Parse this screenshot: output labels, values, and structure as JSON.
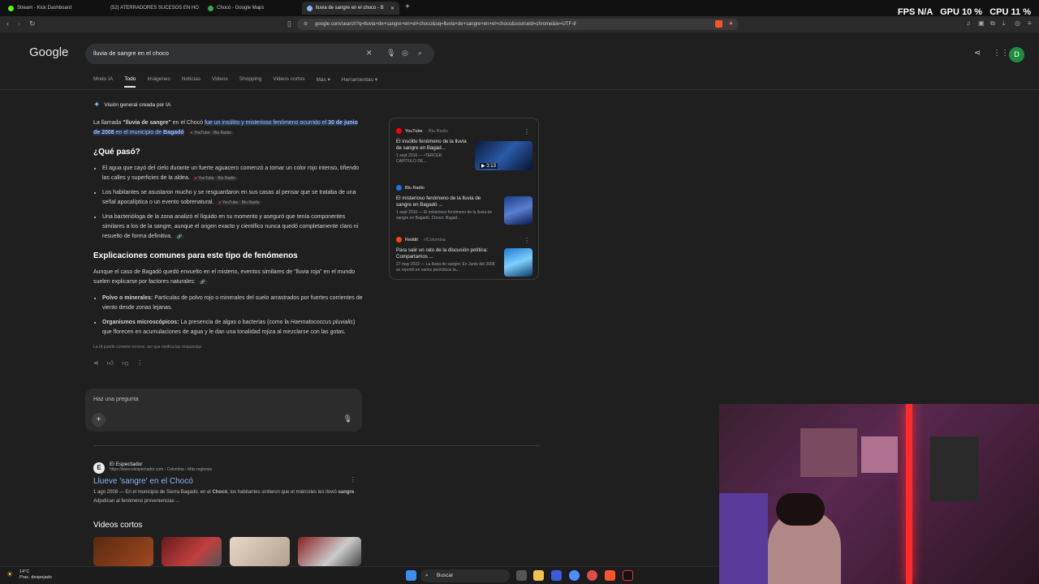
{
  "tabs": [
    {
      "label": "Stream - Kick Dashboard",
      "color": "#53fc18"
    },
    {
      "label": "(52) ATERRADORES SUCESOS EN HO",
      "color": "#ff0000"
    },
    {
      "label": "Chocó - Google Maps",
      "color": "#34a853"
    },
    {
      "label": "lluvia de sangre en el choco - B",
      "color": "#8ab4f8"
    }
  ],
  "address": {
    "url": "google.com/search?q=lluvia+de+sangre+en+el+choco&oq=lluvia+de+sangre+en+el+choco&sourceid=chrome&ie=UTF-8"
  },
  "hud": {
    "fps_label": "FPS",
    "fps": "N/A",
    "gpu_label": "GPU",
    "gpu": "10 %",
    "cpu_label": "CPU",
    "cpu": "11 %"
  },
  "google": {
    "logo": "Google",
    "query": "lluvia de sangre en el choco",
    "avatar": "D",
    "nav_tabs": [
      "Modo IA",
      "Todo",
      "Imágenes",
      "Noticias",
      "Videos",
      "Shopping",
      "Videos cortos",
      "Más ▾",
      "Herramientas ▾"
    ]
  },
  "ai": {
    "header": "Visión general creada por IA",
    "intro_pre": "La llamada ",
    "intro_bold": "\"lluvia de sangre\"",
    "intro_mid": " en el Chocó ",
    "intro_hl1": "fue un insólito y misterioso fenómeno ocurrido el ",
    "intro_hl_date": "30 de junio de 2008",
    "intro_hl2": " en el municipio de ",
    "intro_hl_place": "Bagadó",
    "intro_pill": "YouTube · Blu Radio",
    "h_what": "¿Qué pasó?",
    "what_items": [
      {
        "text": "El agua que cayó del cielo durante un fuerte aguacero comenzó a tomar un color rojo intenso, tiñendo las calles y superficies de la aldea.",
        "pill": "YouTube · Blu Radio"
      },
      {
        "text": "Los habitantes se asustaron mucho y se resguardaron en sus casas al pensar que se trataba de una señal apocalíptica o un evento sobrenatural.",
        "pill": "YouTube · Blu Radio"
      },
      {
        "text": "Una bacterióloga de la zona analizó el líquido en su momento y aseguró que tenía componentes similares a los de la sangre, aunque el origen exacto y científico nunca quedó completamente claro ni resuelto de forma definitiva.",
        "pill": "🔗"
      }
    ],
    "h_expl": "Explicaciones comunes para este tipo de fenómenos",
    "expl_intro": "Aunque el caso de Bagadó quedó envuelto en el misterio, eventos similares de \"lluvia roja\" en el mundo suelen explicarse por factores naturales:",
    "expl_items": [
      {
        "bold": "Polvo o minerales:",
        "text": " Partículas de polvo rojo o minerales del suelo arrastrados por fuertes corrientes de viento desde zonas lejanas."
      },
      {
        "bold": "Organismos microscópicos:",
        "text": " La presencia de algas o bacterias (como la ",
        "ital": "Haematococcus pluvialis",
        "text2": ") que florecen en acumulaciones de agua y le dan una tonalidad rojiza al mezclarse con las gotas."
      }
    ],
    "disclaimer": "La IA puede cometer errores, así que verifica las respuestas"
  },
  "card": [
    {
      "source": "YouTube",
      "sub": "· Blu Radio",
      "dot": "#ff0000",
      "title": "El insólito fenómeno de la lluvia de sangre en Bagad...",
      "snippet": "1 sept 2016 — •TERCER CAPÍTULO DE...",
      "duration": "▶ 3:13"
    },
    {
      "source": "Blu Radio",
      "sub": "",
      "dot": "#1a73e8",
      "title": "El misterioso fenómeno de la lluvia de sangre en Bagadó ...",
      "snippet": "1 sept 2016 — El misterioso fenómeno de la lluvia de sangre en Bagadó, Chocó. Bagad..."
    },
    {
      "source": "Reddit",
      "sub": "· r/Colombia",
      "dot": "#ff4500",
      "title": "Para salir un rato de la discusión política: Compartamos ...",
      "snippet": "27 may 2022 — La lluvia de sangre: En Junio del 2008 se reportó en varios periódicos la..."
    }
  ],
  "ask": {
    "placeholder": "Haz una pregunta"
  },
  "result": {
    "site": "El Espectador",
    "url": "https://www.elespectador.com › Colombia › Más regiones",
    "title": "Llueve 'sangre' en el Chocó",
    "desc_pre": "1 ago 2008 — En el municipio de Sierra Bagadó, en el ",
    "desc_b1": "Chocó",
    "desc_mid": ", los habitantes sintieron que el miércoles les llovió ",
    "desc_b2": "sangre",
    "desc_post": ". Adjudican al fenómeno proveniencias ..."
  },
  "shorts": {
    "title": "Videos cortos"
  },
  "taskbar": {
    "temp": "14°C",
    "weather": "Prac. despejado",
    "search": "Buscar"
  }
}
